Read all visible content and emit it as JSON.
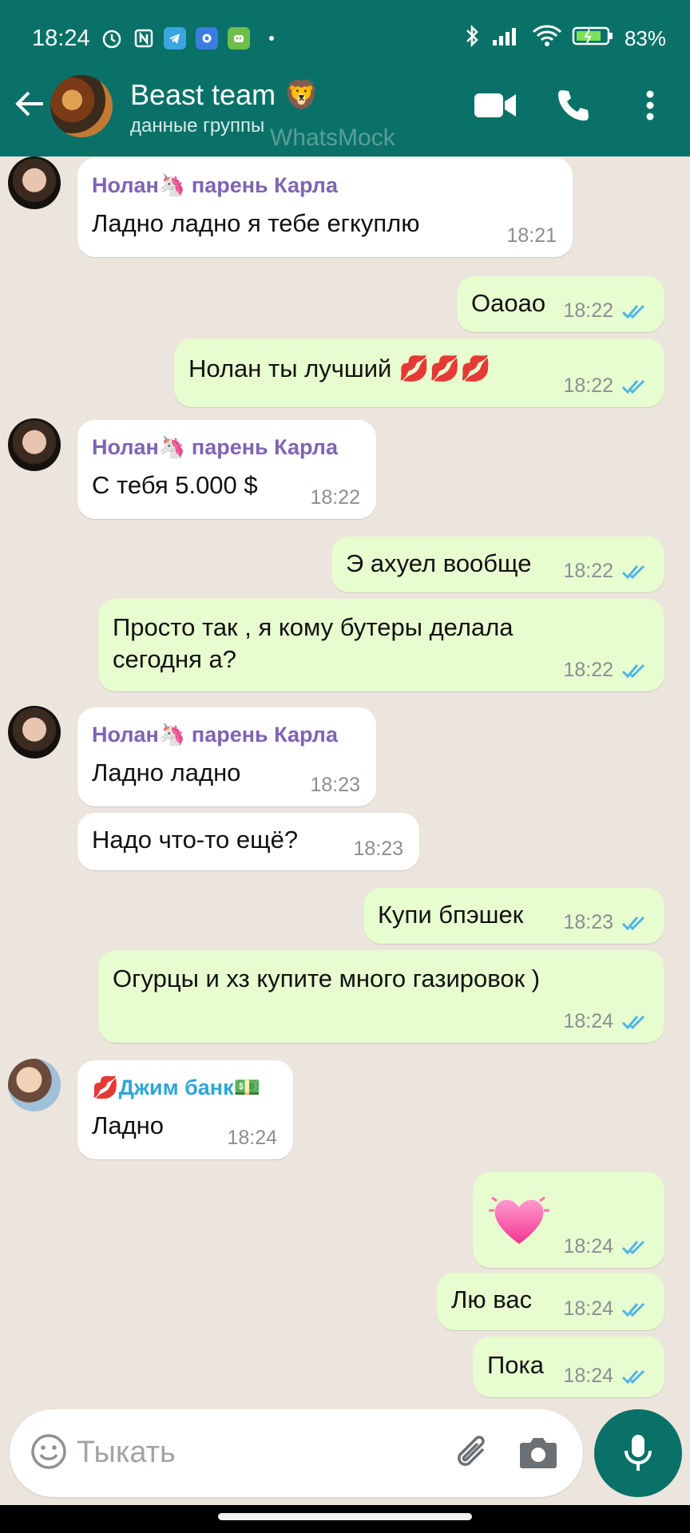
{
  "status_bar": {
    "time": "18:24",
    "battery": "83%"
  },
  "header": {
    "group_name": "Beast team 🦁",
    "subtitle": "данные группы",
    "watermark": "WhatsMock"
  },
  "colors": {
    "header": "#0a7168",
    "incoming": "#ffffff",
    "outgoing": "#e7fccf",
    "tick_blue": "#4fb5e8",
    "sender_purple": "#7f64b3",
    "sender_blue": "#2fa5d8"
  },
  "messages": [
    {
      "dir": "in",
      "sender": "Нолан🦄 парень Карла",
      "text": "Ладно ладно я тебе егкуплю",
      "time": "18:21"
    },
    {
      "dir": "out",
      "text": "Оаоао",
      "time": "18:22"
    },
    {
      "dir": "out",
      "text": "Нолан ты лучший 💋💋💋",
      "time": "18:22"
    },
    {
      "dir": "in",
      "sender": "Нолан🦄 парень Карла",
      "text": "С тебя 5.000 $",
      "time": "18:22"
    },
    {
      "dir": "out",
      "text": "Э ахуел вообще",
      "time": "18:22"
    },
    {
      "dir": "out",
      "text": "Просто так , я кому бутеры делала сегодня а?",
      "time": "18:22"
    },
    {
      "dir": "in",
      "sender": "Нолан🦄 парень Карла",
      "text": "Ладно ладно",
      "time": "18:23"
    },
    {
      "dir": "in",
      "text": "Надо что-то ещё?",
      "time": "18:23"
    },
    {
      "dir": "out",
      "text": "Купи бпэшек",
      "time": "18:23"
    },
    {
      "dir": "out",
      "text": "Огурцы и хз купите много газировок )",
      "time": "18:24"
    },
    {
      "dir": "in",
      "sender": "💋Джим банк💵",
      "text": "Ладно",
      "time": "18:24"
    },
    {
      "dir": "out",
      "emoji": "heart",
      "time": "18:24"
    },
    {
      "dir": "out",
      "text": "Лю вас",
      "time": "18:24"
    },
    {
      "dir": "out",
      "text": "Пока",
      "time": "18:24"
    }
  ],
  "composer": {
    "placeholder": "Тыкать"
  },
  "icons": [
    "back-arrow",
    "video-call",
    "voice-call",
    "more-vert",
    "emoji",
    "attach",
    "camera",
    "mic",
    "double-check"
  ]
}
